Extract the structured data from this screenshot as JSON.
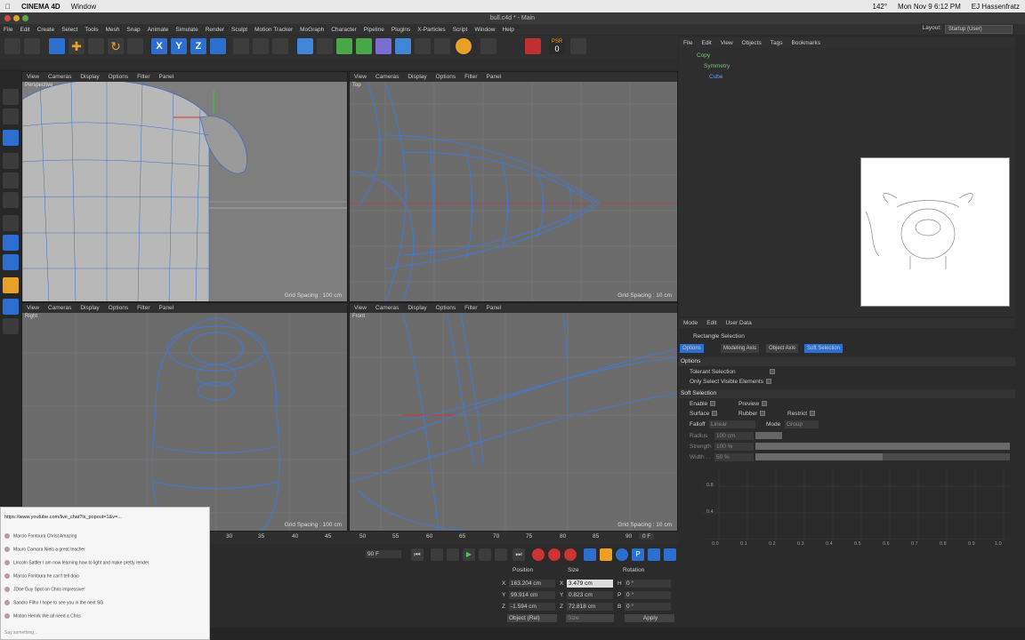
{
  "osx_menu": {
    "apple": "",
    "app": "CINEMA 4D",
    "window": "Window",
    "battery": "142°",
    "datetime": "Mon Nov 9  6:12 PM",
    "user": "EJ Hassenfratz"
  },
  "window_title": "bull.c4d * - Main",
  "menubar": [
    "File",
    "Edit",
    "Create",
    "Select",
    "Tools",
    "Mesh",
    "Snap",
    "Animate",
    "Simulate",
    "Render",
    "Sculpt",
    "Motion Tracker",
    "MoGraph",
    "Character",
    "Pipeline",
    "Plugins",
    "X-Particles",
    "Script",
    "Window",
    "Help"
  ],
  "layout": {
    "label": "Layout:",
    "value": "Startup (User)"
  },
  "toolbar": {
    "xyz": [
      "X",
      "Y",
      "Z"
    ],
    "psr": "PSR",
    "psr_val": "0"
  },
  "viewport_menu": [
    "View",
    "Cameras",
    "Display",
    "Options",
    "Filter",
    "Panel"
  ],
  "viewports": [
    {
      "label": "Perspective",
      "grid": "Grid Spacing : 100 cm"
    },
    {
      "label": "Top",
      "grid": "Grid Spacing : 10 cm"
    },
    {
      "label": "Right",
      "grid": "Grid Spacing : 100 cm"
    },
    {
      "label": "Front",
      "grid": "Grid Spacing : 10 cm"
    }
  ],
  "obj_menu": [
    "File",
    "Edit",
    "View",
    "Objects",
    "Tags",
    "Bookmarks"
  ],
  "objects": [
    "Copy",
    "Symmetry",
    "Cube"
  ],
  "attr_menu": [
    "Mode",
    "Edit",
    "User Data"
  ],
  "attr": {
    "title": "Rectangle Selection",
    "tabs": [
      "Options",
      "Modeling Axis",
      "Object Axis",
      "Soft Selection"
    ],
    "options_header": "Options",
    "tolerant": "Tolerant Selection",
    "visible_only": "Only Select Visible Elements",
    "soft_header": "Soft Selection",
    "enable": "Enable",
    "preview": "Preview",
    "surface": "Surface",
    "rubber": "Rubber",
    "restrict": "Restrict",
    "falloff": "Falloff",
    "falloff_val": "Linear",
    "mode": "Mode",
    "mode_val": "Group",
    "radius": "Radius",
    "radius_val": "100 cm",
    "strength": "Strength",
    "strength_val": "100 %",
    "strength_pct": 1.0,
    "width": "Width . .",
    "width_val": "50 %",
    "width_pct": 0.5
  },
  "graph": {
    "y": [
      "0.8",
      "0.4"
    ],
    "x": [
      "0.0",
      "0.1",
      "0.2",
      "0.3",
      "0.4",
      "0.5",
      "0.6",
      "0.7",
      "0.8",
      "0.9",
      "1.0"
    ]
  },
  "timeline": {
    "ticks": [
      "30",
      "35",
      "40",
      "45",
      "50",
      "55",
      "60",
      "65",
      "70",
      "75",
      "80",
      "85",
      "90"
    ],
    "frame": "0 F",
    "end": "90 F"
  },
  "coords": {
    "headers": [
      "Position",
      "Size",
      "Rotation"
    ],
    "rows": [
      {
        "a": "X",
        "pos": "163.204 cm",
        "b": "X",
        "size": "3.479 cm",
        "c": "H",
        "rot": "0 °"
      },
      {
        "a": "Y",
        "pos": "99.914 cm",
        "b": "Y",
        "size": "0.823 cm",
        "c": "P",
        "rot": "0 °"
      },
      {
        "a": "Z",
        "pos": "-1.594 cm",
        "b": "Z",
        "size": "72.818 cm",
        "c": "B",
        "rot": "0 °"
      }
    ],
    "mode": "Object (Rel)",
    "size_mode": "Size",
    "apply": "Apply"
  },
  "chat": {
    "url": "https://www.youtube.com/live_chat?is_popout=1&v=...",
    "messages": [
      "Marcio Fontoura  Christ Amazing",
      "Mauro Camara  Niels a great teacher",
      "Lincoln Sattler  I am now learning how to light and make pretty render",
      "Marcio Fontoura  he can't tell dojo",
      "JDoe Guy  Spot on Chris impressive!",
      "Sandro Filho  I hope to see you in the next SG",
      "Motion Henrik  We all need a Chris"
    ],
    "input": "Say something..."
  }
}
